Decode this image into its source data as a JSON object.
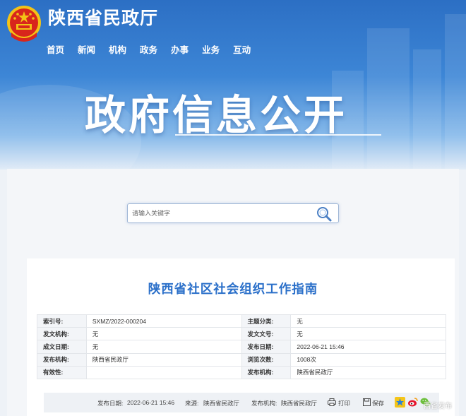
{
  "header": {
    "site_title": "陕西省民政厅",
    "emblem_icon": "national-emblem-icon",
    "nav": [
      {
        "label": "首页"
      },
      {
        "label": "新闻"
      },
      {
        "label": "机构"
      },
      {
        "label": "政务"
      },
      {
        "label": "办事"
      },
      {
        "label": "业务"
      },
      {
        "label": "互动"
      }
    ]
  },
  "hero": {
    "title": "政府信息公开"
  },
  "search": {
    "placeholder": "请输入关键字",
    "icon": "search-icon"
  },
  "document": {
    "title": "陕西省社区社会组织工作指南",
    "meta_rows": [
      {
        "k1": "索引号:",
        "v1": "SXMZ/2022-000204",
        "k2": "主题分类:",
        "v2": "无"
      },
      {
        "k1": "发文机构:",
        "v1": "无",
        "k2": "发文文号:",
        "v2": "无"
      },
      {
        "k1": "成文日期:",
        "v1": "无",
        "k2": "发布日期:",
        "v2": "2022-06-21 15:46"
      },
      {
        "k1": "发布机构:",
        "v1": "陕西省民政厅",
        "k2": "浏览次数:",
        "v2": "1008次"
      },
      {
        "k1": "有效性:",
        "v1": "",
        "k2": "发布机构:",
        "v2": "陕西省民政厅"
      }
    ]
  },
  "footer": {
    "date_label": "发布日期:",
    "date_value": "2022-06-21 15:46",
    "source_label": "来源:",
    "source_value": "陕西省民政厅",
    "org_label": "发布机构:",
    "org_value": "陕西省民政厅",
    "print_label": "打印",
    "save_label": "保存"
  },
  "watermark": "西省发布",
  "colors": {
    "accent": "#2a6fc9",
    "banner_top": "#2c6fc4",
    "emblem_red": "#d8261c",
    "emblem_gold": "#f3c316"
  }
}
